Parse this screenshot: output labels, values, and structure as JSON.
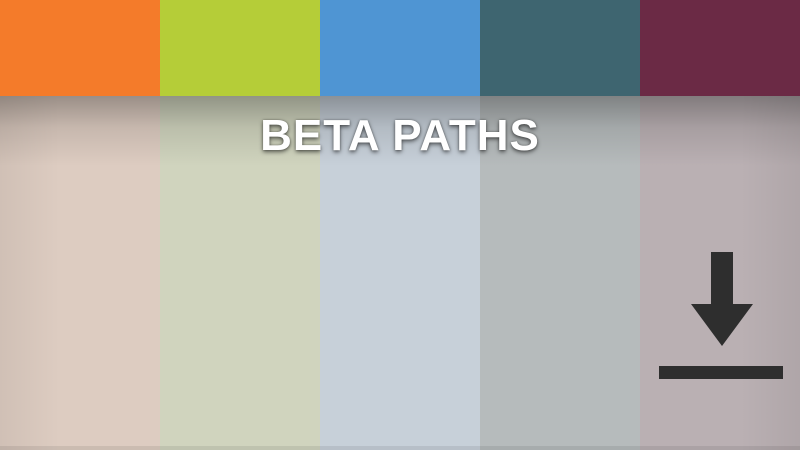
{
  "title": "BETA PATHS",
  "columns": [
    {
      "bar_color": "#F47B2A",
      "body_color": "#DDCCC1"
    },
    {
      "bar_color": "#B5CD38",
      "body_color": "#D0D4BE"
    },
    {
      "bar_color": "#4F95D3",
      "body_color": "#C7D0D9"
    },
    {
      "bar_color": "#3E6570",
      "body_color": "#B6BBBC"
    },
    {
      "bar_color": "#6B2A45",
      "body_color": "#BAB0B3"
    }
  ],
  "icons": {
    "download": "download-icon",
    "color": "#2E2E2E"
  }
}
